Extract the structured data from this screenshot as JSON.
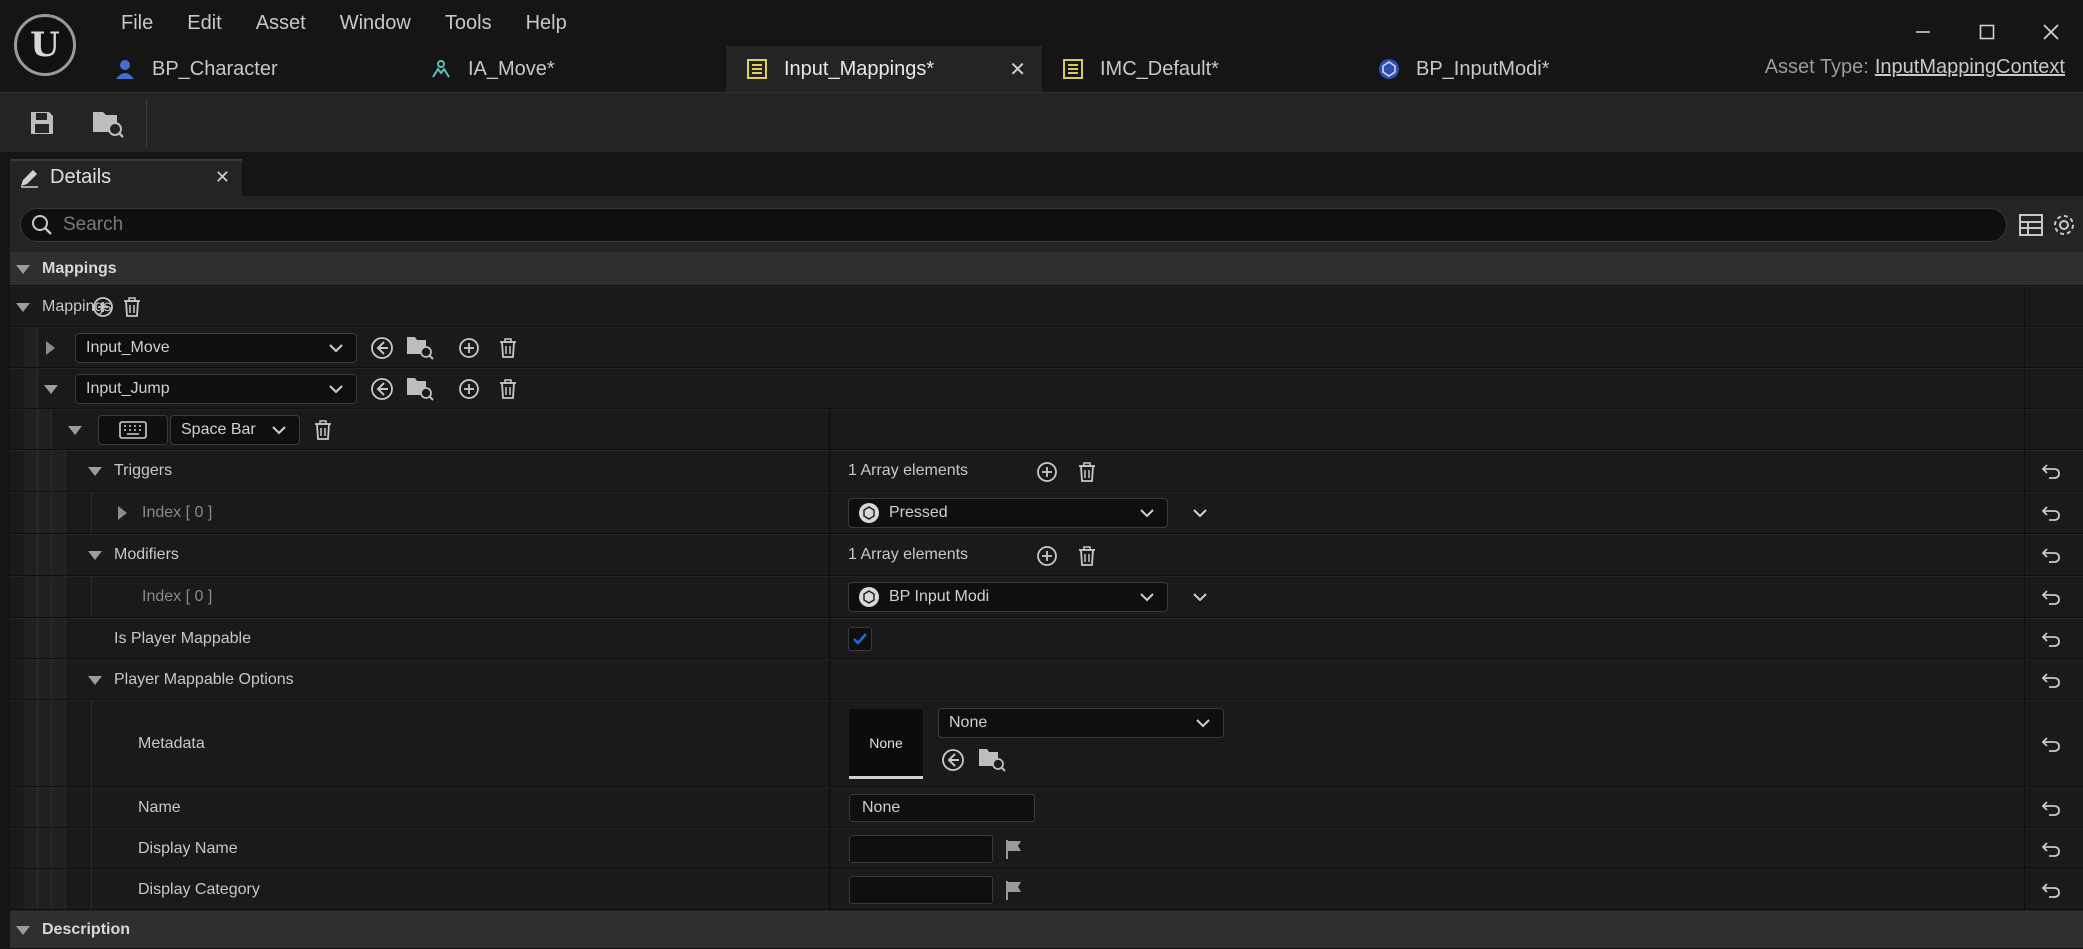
{
  "menu": [
    "File",
    "Edit",
    "Asset",
    "Window",
    "Tools",
    "Help"
  ],
  "tabs": [
    {
      "label": "BP_Character",
      "icon": "character-icon",
      "active": false
    },
    {
      "label": "IA_Move*",
      "icon": "input-action-icon",
      "active": false
    },
    {
      "label": "Input_Mappings*",
      "icon": "mapping-context-icon",
      "active": true
    },
    {
      "label": "IMC_Default*",
      "icon": "mapping-context-icon",
      "active": false
    },
    {
      "label": "BP_InputModi*",
      "icon": "blueprint-icon",
      "active": false
    }
  ],
  "asset_type": {
    "label": "Asset Type:",
    "value": "InputMappingContext"
  },
  "details": {
    "tab_label": "Details",
    "search_placeholder": "Search",
    "category_mappings": "Mappings",
    "mappings_label": "Mappings",
    "mapping_1": "Input_Move",
    "mapping_2": "Input_Jump",
    "key": "Space Bar",
    "triggers_label": "Triggers",
    "triggers_count": "1 Array elements",
    "trigger_index": "Index [ 0 ]",
    "trigger_value": "Pressed",
    "modifiers_label": "Modifiers",
    "modifiers_count": "1 Array elements",
    "modifier_index": "Index [ 0 ]",
    "modifier_value": "BP Input Modi",
    "is_player_mappable_label": "Is Player Mappable",
    "is_player_mappable": true,
    "player_mappable_options_label": "Player Mappable Options",
    "metadata_label": "Metadata",
    "metadata_thumb": "None",
    "metadata_value": "None",
    "name_label": "Name",
    "name_value": "None",
    "display_name_label": "Display Name",
    "display_name_value": "",
    "display_category_label": "Display Category",
    "display_category_value": "",
    "category_description": "Description"
  },
  "colors": {
    "accent_check": "#1a6fd6",
    "background": "#151515",
    "panel": "#242424"
  }
}
